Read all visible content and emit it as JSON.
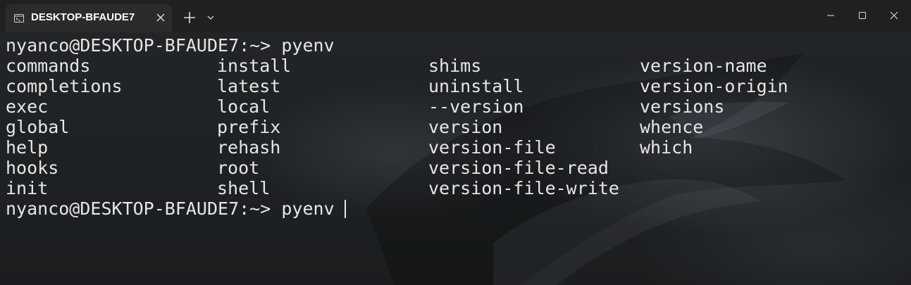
{
  "window": {
    "tab_title": "DESKTOP-BFAUDE7",
    "tab_icon": "terminal-icon",
    "new_tab_icon": "plus-icon",
    "dropdown_icon": "chevron-down-icon",
    "controls": [
      "minimize-icon",
      "maximize-icon",
      "close-icon"
    ]
  },
  "terminal": {
    "prompt": "nyanco@DESKTOP-BFAUDE7:~> ",
    "command": "pyenv",
    "columns": [
      [
        "commands",
        "completions",
        "exec",
        "global",
        "help",
        "hooks",
        "init"
      ],
      [
        "install",
        "latest",
        "local",
        "prefix",
        "rehash",
        "root",
        "shell"
      ],
      [
        "shims",
        "uninstall",
        "--version",
        "version",
        "version-file",
        "version-file-read",
        "version-file-write"
      ],
      [
        "version-name",
        "version-origin",
        "versions",
        "whence",
        "which"
      ]
    ],
    "current_input": "pyenv "
  },
  "colors": {
    "titlebar": "#202020",
    "tab": "#2b2b2b",
    "text": "#e6e6e6"
  }
}
